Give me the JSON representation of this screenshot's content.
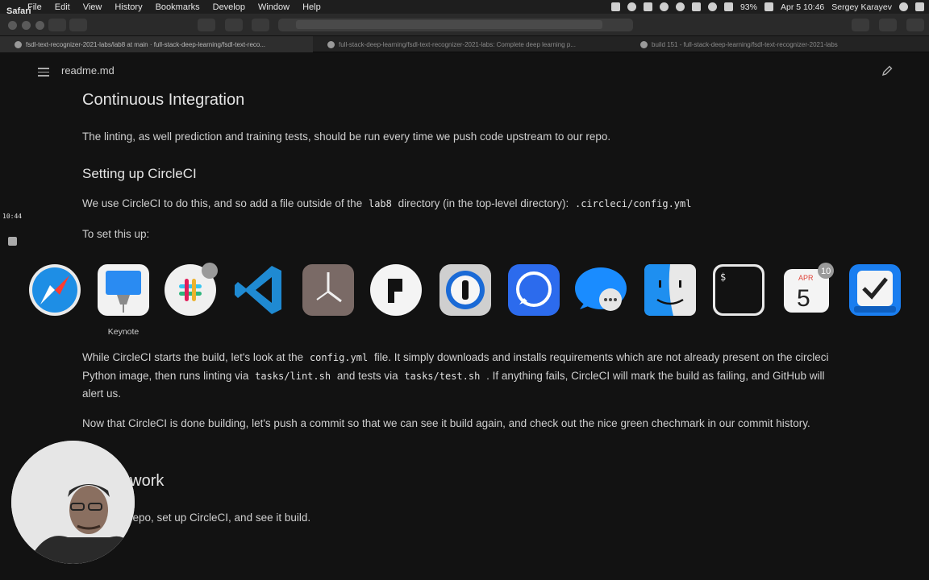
{
  "menubar": {
    "app_name": "Safari",
    "items": [
      "File",
      "Edit",
      "View",
      "History",
      "Bookmarks",
      "Develop",
      "Window",
      "Help"
    ],
    "battery": "93%",
    "datetime": "Apr 5  10:46",
    "user": "Sergey Karayev"
  },
  "tabs": [
    {
      "label": "fsdl-text-recognizer-2021-labs/lab8 at main · full-stack-deep-learning/fsdl-text-reco..."
    },
    {
      "label": "full-stack-deep-learning/fsdl-text-recognizer-2021-labs: Complete deep learning p..."
    },
    {
      "label": "build 151 - full-stack-deep-learning/fsdl-text-recognizer-2021-labs"
    }
  ],
  "doc": {
    "filename": "readme.md",
    "h_ci": "Continuous Integration",
    "p_ci": "The linting, as well prediction and training tests, should be run every time we push code upstream to our repo.",
    "h_setup": "Setting up CircleCI",
    "p_setup_a": "We use CircleCI to do this, and so add a file outside of the",
    "p_setup_code1": "lab8",
    "p_setup_b": "directory (in the top-level directory):",
    "p_setup_code2": ".circleci/config.yml",
    "p_setup2": "To set this up:",
    "p_build_a": "While CircleCI starts the build, let's look at the",
    "p_build_code1": "config.yml",
    "p_build_b": "file. It simply downloads and installs requirements which are not already present on the circleci Python image, then runs linting via",
    "p_build_code2": "tasks/lint.sh",
    "p_build_c": "and tests via",
    "p_build_code3": "tasks/test.sh",
    "p_build_d": ". If anything fails, CircleCI will mark the build as failing, and GitHub will alert us.",
    "p_done": "Now that CircleCI is done building, let's push a commit so that we can see it build again, and check out the nice green chechmark in our commit history.",
    "h_hw": "ework",
    "p_hw": "repo, set up CircleCI, and see it build."
  },
  "overlay": {
    "clock": "10:44"
  },
  "switcher": {
    "selected_label": "Keynote",
    "calendar_month": "APR",
    "calendar_day": "5",
    "calendar_badge": "10",
    "apps": [
      "safari",
      "keynote",
      "slack",
      "vscode",
      "klokki",
      "pastebot",
      "1password",
      "signal",
      "messages",
      "finder",
      "terminal",
      "calendar",
      "things"
    ]
  },
  "colors": {
    "background": "#121212",
    "vscode_blue": "#1f8ad2",
    "safari_blue": "#1e8ee5",
    "signal_blue": "#2c6bed",
    "messages_blue": "#1a8cff"
  }
}
